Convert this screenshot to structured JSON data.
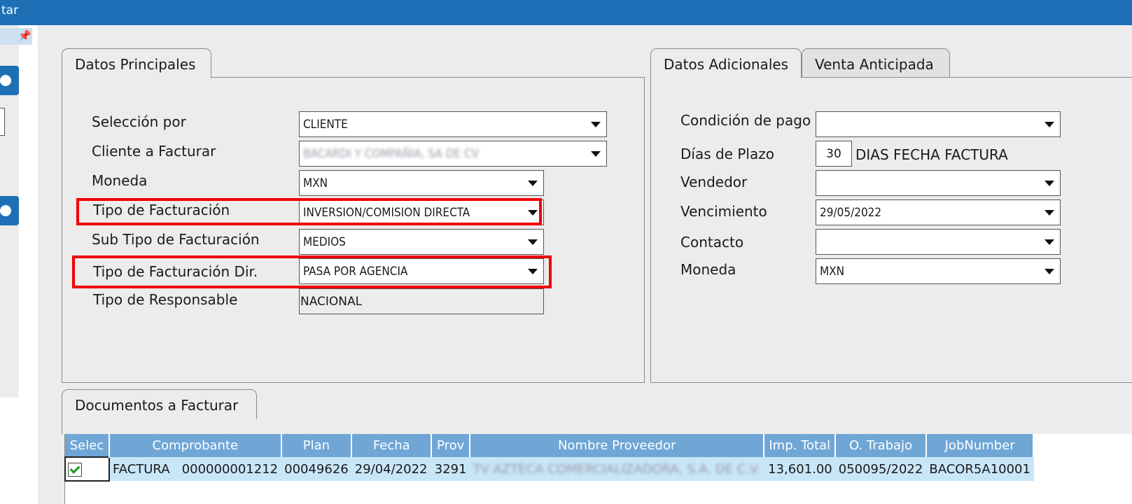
{
  "window": {
    "title_partial": "tar"
  },
  "tabs_main": {
    "datos_principales": "Datos Principales"
  },
  "tabs_right": {
    "datos_adicionales": "Datos Adicionales",
    "venta_anticipada": "Venta Anticipada"
  },
  "tabs_docs": {
    "documentos": "Documentos a Facturar"
  },
  "principal": {
    "seleccion_label": "Selección por",
    "seleccion_value": "CLIENTE",
    "cliente_label": "Cliente a Facturar",
    "cliente_value": "BACARDI Y COMPAÑIA, SA DE CV",
    "moneda_label": "Moneda",
    "moneda_value": "MXN",
    "tipo_fact_label": "Tipo de Facturación",
    "tipo_fact_value": "INVERSION/COMISION DIRECTA",
    "subtipo_label": "Sub Tipo de Facturación",
    "subtipo_value": "MEDIOS",
    "tipo_dir_label": "Tipo de Facturación Dir.",
    "tipo_dir_value": "PASA POR AGENCIA",
    "responsable_label": "Tipo de Responsable",
    "responsable_value": "NACIONAL"
  },
  "adicional": {
    "condicion_label": "Condición de pago",
    "condicion_value": "",
    "dias_label": "Días de Plazo",
    "dias_value": "30",
    "dias_text": "DIAS FECHA FACTURA",
    "vendedor_label": "Vendedor",
    "vendedor_value": "",
    "vencimiento_label": "Vencimiento",
    "vencimiento_value": "29/05/2022",
    "contacto_label": "Contacto",
    "contacto_value": "",
    "moneda_label": "Moneda",
    "moneda_value": "MXN"
  },
  "grid": {
    "headers": [
      "Selec",
      "Comprobante",
      "Plan",
      "Fecha",
      "Prov",
      "Nombre Proveedor",
      "Imp. Total",
      "O. Trabajo",
      "JobNumber"
    ],
    "rows": [
      {
        "selected": true,
        "comprobante": "FACTURA   000000001212",
        "plan": "00049626",
        "fecha": "29/04/2022",
        "prov": "3291",
        "nombre": "TV AZTECA COMERCIALIZADORA, S.A. DE C.V.",
        "total": "13,601.00",
        "trabajo": "050095/2022",
        "job": "BACOR5A10001"
      }
    ]
  },
  "colors": {
    "titlebar": "#1e6fb5",
    "header": "#6fa6d6",
    "row": "#c8e6f8",
    "highlight": "#f00000",
    "panel": "#ececec"
  },
  "icons": {
    "pin": "pin-icon"
  }
}
